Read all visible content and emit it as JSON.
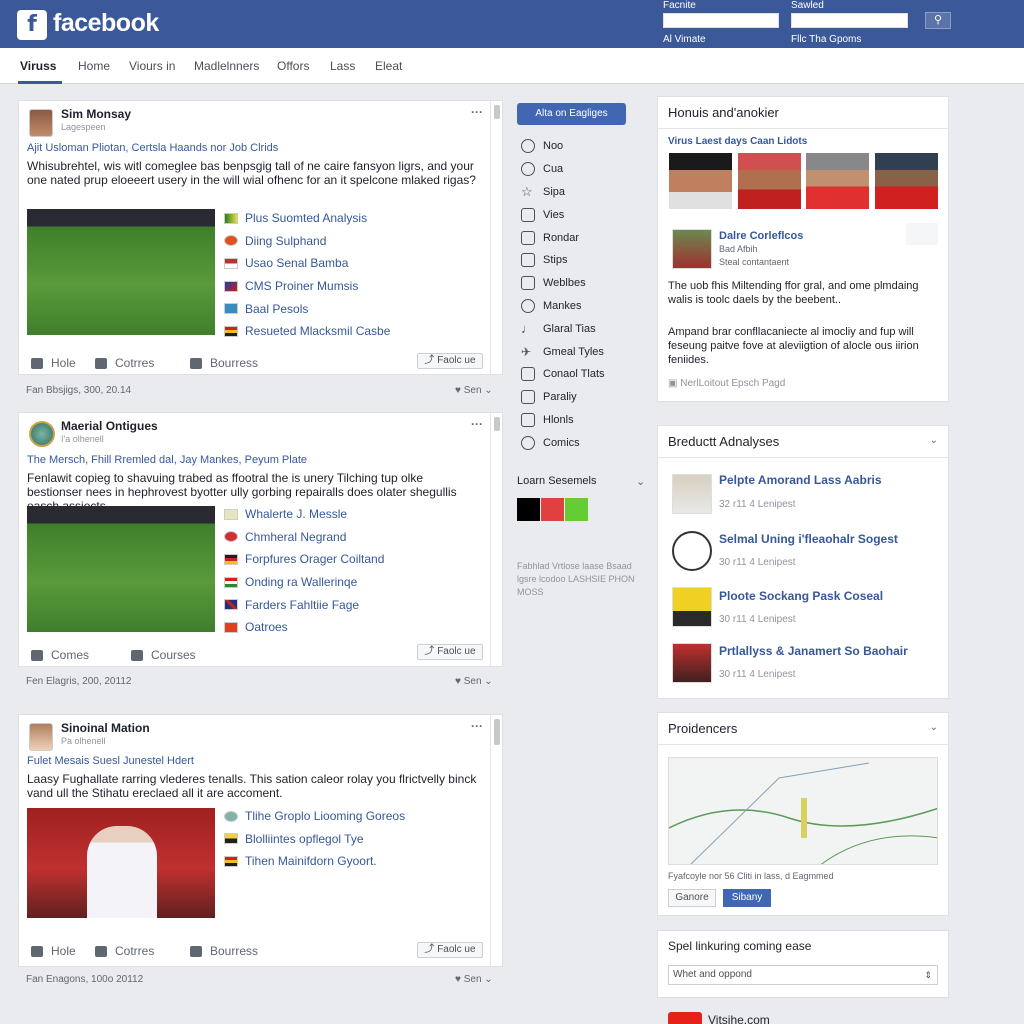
{
  "topbar": {
    "logo_letter": "f",
    "logo_text": "facebook",
    "field1_label": "Facnite",
    "field2_label": "Sawled",
    "below1": "Al Vimate",
    "below2": "Fllc Tha Gpoms",
    "search_icon": "magnifier-icon"
  },
  "nav": {
    "items": [
      "Viruss",
      "Home",
      "Viours in",
      "Madlelnners",
      "Offors",
      "Lass",
      "Eleat"
    ]
  },
  "posts": [
    {
      "name": "Sim Monsay",
      "sub": "Lagespeen",
      "link": "Ajit Usloman Pliotan, Certsla Haands nor Job Clrids",
      "text": "Whisubrehtel, wis witl comeglee bas benpsgig tall of ne caire fansyon ligrs, and your one nated prup eloeeert usery in the will wial ofhenc for an it spelcone mlaked rigas?",
      "links": [
        "Plus Suomted Analysis",
        "Diing Sulphand",
        "Usao Senal Bamba",
        "CMS Proiner Mumsis",
        "Baal Pesols",
        "Resueted Mlacksmil Casbe"
      ],
      "actions": [
        "Hole",
        "Cotrres",
        "Bourress"
      ],
      "follow": "Faolc ue",
      "date": "Fan Bbsjigs, 300, 20.14",
      "shares": "Sen"
    },
    {
      "name": "Maerial Ontigues",
      "sub": "I'a olhenell",
      "link": "The Mersch, Fhill Rremled dal, Jay Mankes, Peyum Plate",
      "text": "Fenlawit copieg to shavuing trabed as ffootral the is unery Tilching tup olke bestionser nees in hephrovest byotter ully gorbing repairalls does olater shegullis easch assiects.",
      "links": [
        "Whalerte J. Messle",
        "Chmheral Negrand",
        "Forpfures Orager Coiltand",
        "Onding ra Wallerinqe",
        "Farders Fahltiie Fage",
        "Oatroes"
      ],
      "actions": [
        "Comes",
        "Courses"
      ],
      "follow": "Faolc ue",
      "date": "Fen Elagris, 200, 20112",
      "shares": "Sen"
    },
    {
      "name": "Sinoinal Mation",
      "sub": "Pa olhenell",
      "link": "Fulet Mesais Suesl Junestel Hdert",
      "text": "Laasy Fughallate rarring vlederes tenalls. This sation caleor rolay you flrictvelly binck vand ull the Stihatu ereclaed all it are accoment.",
      "links": [
        "Tlihe Groplo Liooming Goreos",
        "Blolliintes opflegol Tye",
        "Tihen Mainifdorn Gyoort."
      ],
      "actions": [
        "Hole",
        "Cotrres",
        "Bourress"
      ],
      "follow": "Faolc ue",
      "date": "Fan Enagons, 100o 20112",
      "shares": "Sen"
    }
  ],
  "middle": {
    "button": "Alta on Eagliges",
    "items": [
      "Noo",
      "Cua",
      "Sipa",
      "Vies",
      "Rondar",
      "Stips",
      "Weblbes",
      "Mankes",
      "Glaral Tias",
      "Gmeal Tyles",
      "Conaol Tlats",
      "Paraliy",
      "Hlonls",
      "Comics"
    ],
    "section": "Loarn Sesemels",
    "footer": "Fabhlad Vrtlose laase Bsaad lgsre lcodoo LASHSIE PHON MOSS",
    "swatch_colors": [
      "#000000",
      "#e04040",
      "#66cc33"
    ]
  },
  "right": {
    "card1": {
      "title": "Honuis and'anokier",
      "link": "Virus Laest days Caan Lidots",
      "person_name": "Dalre Corleflcos",
      "person_sub1": "Bad Afbih",
      "person_sub2": "Steal contantaent",
      "text1": "The uob fhis Miltending ffor gral, and ome plmdaing walis is toolc daels by the beebent..",
      "text2": "Ampand brar confllacaniecte al imocliy and fup will feseung paitve fove at aleviigtion of alocle ous iirion feniides.",
      "footer": "NerlLoitout Epsch Pagd"
    },
    "card2": {
      "title": "Breductt Adnalyses",
      "items": [
        {
          "title": "Pelpte Amorand Lass Aabris",
          "sub": "32 r11 4 Lenipest"
        },
        {
          "title": "Selmal Uning i'fleaohalr Sogest",
          "sub": "30 r11 4 Lenipest"
        },
        {
          "title": "Ploote Sockang Pask Coseal",
          "sub": "30 r11 4 Lenipest"
        },
        {
          "title": "Prtlallyss & Janamert So Baohair",
          "sub": "30 r11 4 Lenipest"
        }
      ]
    },
    "card3": {
      "title": "Proidencers",
      "caption": "Fyafcoyle nor 56 Cliti in lass, d Eagmmed",
      "btn1": "Ganore",
      "btn2": "Sibany"
    },
    "card4": {
      "title": "Spel linkuring coming ease",
      "select": "Whet and oppond"
    },
    "youtube": "Vitsihe.com"
  },
  "colors": {
    "brand": "#3b5998",
    "link": "#365899",
    "background": "#e9ebee"
  }
}
